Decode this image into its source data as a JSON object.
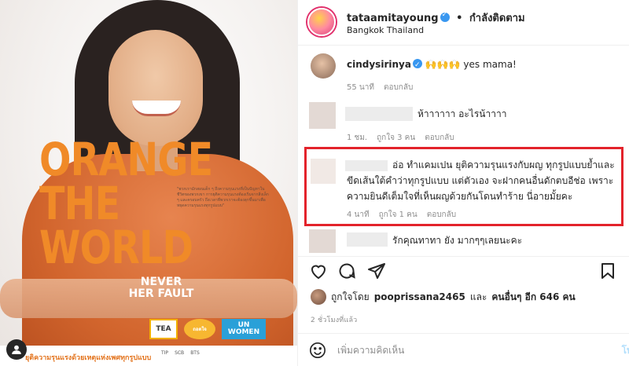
{
  "post_image": {
    "headline_lines": [
      "ORANGE",
      "THE",
      "WORLD"
    ],
    "quote": "\"พวกเรามักสอนเด็ก ๆ ถึงความรุนแรงที่เป็นปัญหาในชีวิตของพวกเขา การยุติความรุนแรงต้องเริ่มจากสิ่งเล็ก ๆ และครอบครัว ถึงเวลาที่พวกเราจะต้องลุกขึ้นมาเพื่อหยุดความรุนแรงทุกรูปแบบ\"",
    "tagline_lines": [
      "NEVER",
      "HER FAULT"
    ],
    "banner_text": "ยุติความรุนแรงด้วยเหตุแห่งเพศทุกรูปแบบ",
    "logos": [
      "TEA",
      "ถอดใจ",
      "UN WOMEN"
    ],
    "banner_logos": [
      "TIP",
      "SCB",
      "BTS"
    ]
  },
  "header": {
    "username": "tataamitayoung",
    "follow_label": "กำลังติดตาม",
    "location": "Bangkok Thailand",
    "verified": true
  },
  "comments": [
    {
      "username": "cindysirinya",
      "verified": true,
      "text": "🙌🙌🙌 yes mama!",
      "time": "55 นาที",
      "reply_label": "ตอบกลับ",
      "likes": ""
    },
    {
      "username": "",
      "text": "ห้าาาาาา อะไรน้าาาา",
      "time": "1 ชม.",
      "likes": "ถูกใจ 3 คน",
      "reply_label": "ตอบกลับ"
    },
    {
      "username": "",
      "text": "อ่อ ทำแคมเปน ยุติความรุนแรงกับผญ ทุกรูปแบบย้ำและขีดเส้นใต้คำว่าทุกรูปแบบ แต่ตัวเอง จะฝากคนอื่นดักตบอีช่อ เพราะความยินดีเต็มใจที่เห็นผญด้วยกันโดนทำร้าย นี่อายมั้ยคะ",
      "time": "4 นาที",
      "likes": "ถูกใจ 1 คน",
      "reply_label": "ตอบกลับ"
    },
    {
      "username": "",
      "text": "รักคุณทาทา ยัง มากๆๆเลยนะคะ"
    }
  ],
  "likes_line": {
    "prefix": "ถูกใจโดย",
    "user": "pooprissana2465",
    "mid": "และ",
    "others": "คนอื่นๆ อีก 646 คน"
  },
  "time_ago": "2 ชั่วโมงที่แล้ว",
  "add_comment": {
    "placeholder": "เพิ่มความคิดเห็น",
    "post_label": "โพ"
  },
  "colors": {
    "accent_blue": "#3897f0",
    "highlight_red": "#e3232b",
    "brand_orange": "#f08a28"
  }
}
